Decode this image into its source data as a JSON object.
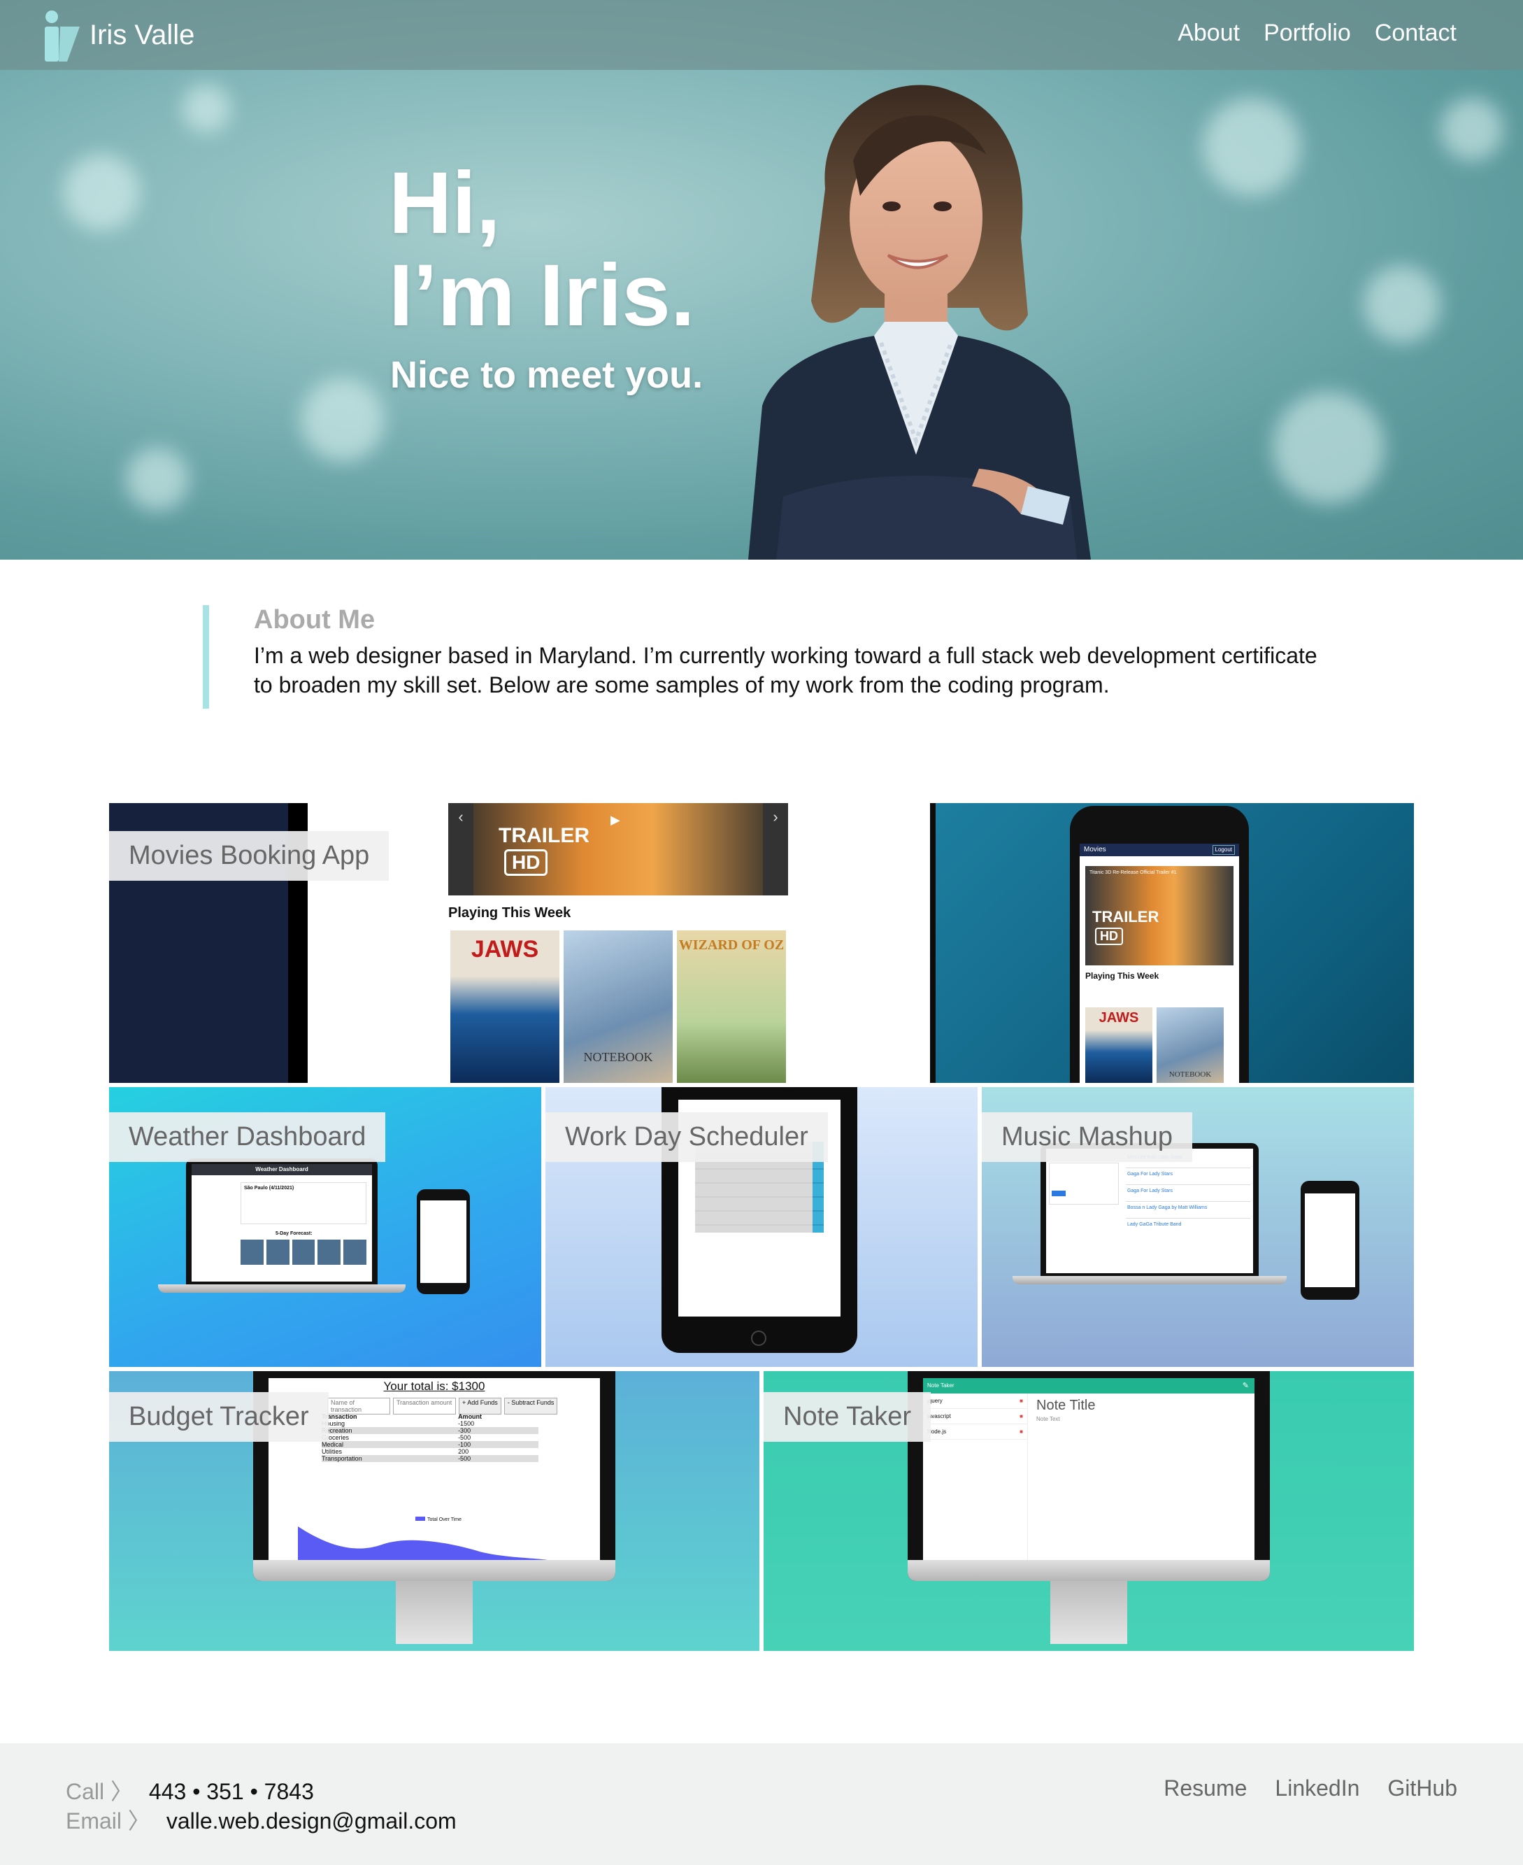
{
  "nav": {
    "brand": "Iris Valle",
    "links": [
      "About",
      "Portfolio",
      "Contact"
    ]
  },
  "hero": {
    "line1": "Hi,",
    "line2": "I’m Iris.",
    "subtitle": "Nice to meet you."
  },
  "about": {
    "heading": "About Me",
    "body": "I’m a web designer based in Maryland. I’m currently working toward a full stack web development certificate to broaden my skill set. Below are some samples of my work from the coding program."
  },
  "projects": {
    "movies": {
      "title": "Movies Booking App",
      "trailer": "TRAILER",
      "hd": "HD",
      "playing": "Playing This Week",
      "posters": [
        "JAWS",
        "NOTEBOOK",
        "WIZARD OF OZ"
      ],
      "app_header": "Movies",
      "app_button": "Logout",
      "app_trailer_caption": "Titanic 3D Re-Release Official Trailer #1"
    },
    "weather": {
      "title": "Weather Dashboard",
      "screen_title": "Weather Dashboard",
      "city": "São Paulo (4/11/2021)",
      "forecast": "5-Day Forecast:"
    },
    "scheduler": {
      "title": "Work Day Scheduler"
    },
    "music": {
      "title": "Music Mashup",
      "songs": [
        "Mim Lee feat. Lady Gaga",
        "Gaga For Lady Stars",
        "Gaga For Lady Stars",
        "Bossa n Lady Gaga by Matt Williams",
        "Lady GaGa Tribute Band"
      ]
    },
    "budget": {
      "title": "Budget Tracker",
      "total": "Your total is: $1300",
      "name_placeholder": "Name of transaction",
      "amount_placeholder": "Transaction amount",
      "add": "+ Add Funds",
      "subtract": "- Subtract Funds",
      "table_headers": [
        "Transaction",
        "Amount"
      ],
      "rows": [
        [
          "Housing",
          "-1500"
        ],
        [
          "Recreation",
          "-300"
        ],
        [
          "Groceries",
          "-500"
        ],
        [
          "Medical",
          "-100"
        ],
        [
          "Utilities",
          "200"
        ],
        [
          "Transportation",
          "-500"
        ]
      ],
      "legend": "Total Over Time"
    },
    "notes": {
      "title": "Note Taker",
      "app_title": "Note Taker",
      "items": [
        "jquery",
        "javascript",
        "Node.js"
      ],
      "note_title": "Note Title",
      "note_text": "Note Text"
    }
  },
  "footer": {
    "call_label": "Call 〉",
    "phone": "443 • 351 • 7843",
    "email_label": "Email 〉",
    "email": "valle.web.design@gmail.com",
    "links": [
      "Resume",
      "LinkedIn",
      "GitHub"
    ]
  },
  "colors": {
    "accent": "#a5e3e4",
    "nav_bg": "#6e8c8c",
    "footer_bg": "#f0f1f1"
  }
}
